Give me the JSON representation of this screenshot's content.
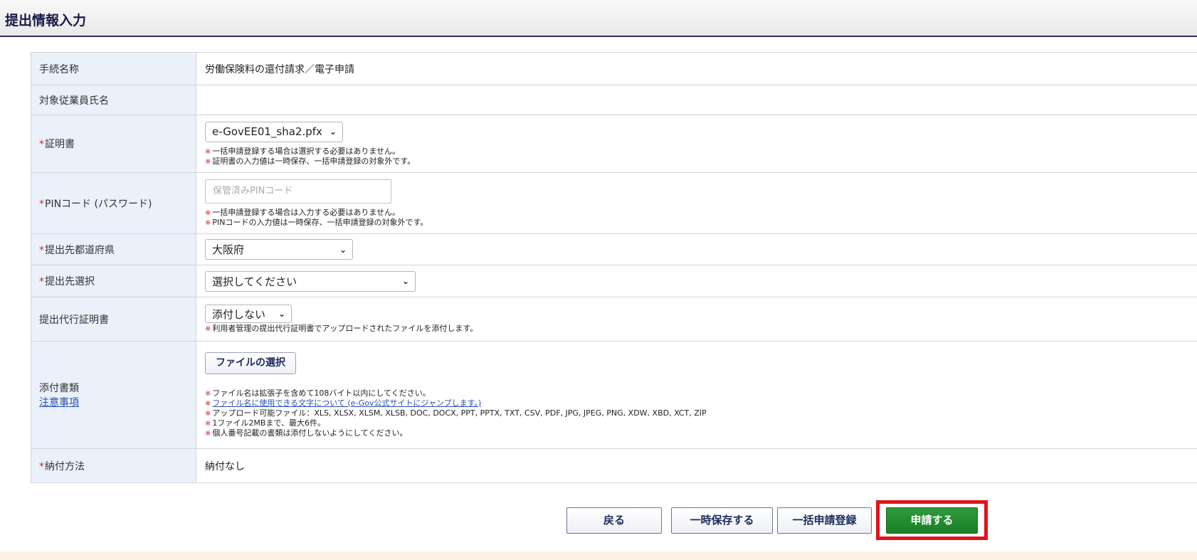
{
  "header": {
    "title": "提出情報入力"
  },
  "required_mark": "*",
  "note_mark": "※",
  "rows": {
    "procedure_name": {
      "label": "手続名称",
      "value": "労働保険料の還付請求／電子申請"
    },
    "employee_name": {
      "label": "対象従業員氏名",
      "value": ""
    },
    "certificate": {
      "label": "証明書",
      "selected": "e-GovEE01_sha2.pfx",
      "notes": [
        "一括申請登録する場合は選択する必要はありません。",
        "証明書の入力値は一時保存、一括申請登録の対象外です。"
      ]
    },
    "pin": {
      "label": "PINコード (パスワード)",
      "placeholder": "保管済みPINコード",
      "notes": [
        "一括申請登録する場合は入力する必要はありません。",
        "PINコードの入力値は一時保存、一括申請登録の対象外です。"
      ]
    },
    "prefecture": {
      "label": "提出先都道府県",
      "selected": "大阪府"
    },
    "destination": {
      "label": "提出先選択",
      "selected": "選択してください"
    },
    "proxy_certificate": {
      "label": "提出代行証明書",
      "selected": "添付しない",
      "notes": [
        "利用者管理の提出代行証明書でアップロードされたファイルを添付します。"
      ]
    },
    "attachments": {
      "label": "添付書類",
      "caution_link": "注意事項",
      "file_button": "ファイルの選択",
      "notes": [
        "ファイル名は拡張子を含めて108バイト以内にしてください。",
        "ファイル名に使用できる文字について (e-Gov公式サイトにジャンプします。)",
        "アップロード可能ファイル：XLS, XLSX, XLSM, XLSB, DOC, DOCX, PPT, PPTX, TXT, CSV, PDF, JPG, JPEG, PNG, XDW, XBD, XCT, ZIP",
        "1ファイル2MBまで、最大6件。",
        "個人番号記載の書類は添付しないようにしてください。"
      ]
    },
    "payment": {
      "label": "納付方法",
      "value": "納付なし"
    }
  },
  "buttons": {
    "back": "戻る",
    "save_temp": "一時保存する",
    "bulk_register": "一括申請登録",
    "submit": "申請する"
  },
  "colors": {
    "highlight": "#e3141b",
    "submit": "#1b7f27",
    "label_bg": "#eaf1fb"
  }
}
